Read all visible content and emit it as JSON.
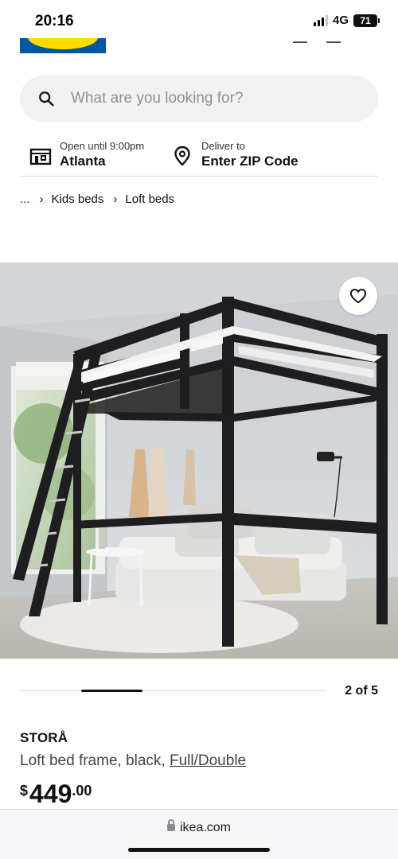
{
  "status_bar": {
    "time": "20:16",
    "network": "4G",
    "battery": "71"
  },
  "search": {
    "placeholder": "What are you looking for?"
  },
  "store": {
    "hours": "Open until 9:00pm",
    "name": "Atlanta"
  },
  "delivery": {
    "label": "Deliver to",
    "action": "Enter ZIP Code"
  },
  "breadcrumb": {
    "ellipsis": "...",
    "items": [
      "Kids beds",
      "Loft beds"
    ]
  },
  "carousel": {
    "counter": "2 of 5",
    "position": 2,
    "total": 5
  },
  "product": {
    "name": "STORÅ",
    "description_prefix": "Loft bed frame, black, ",
    "size_link": "Full/Double",
    "price_currency": "$",
    "price_int": "449",
    "price_dec": ".00"
  },
  "browser": {
    "url": "ikea.com"
  },
  "colors": {
    "brand_blue": "#0058a3",
    "brand_yellow": "#ffdb00",
    "frame": "#1d1d1f"
  }
}
